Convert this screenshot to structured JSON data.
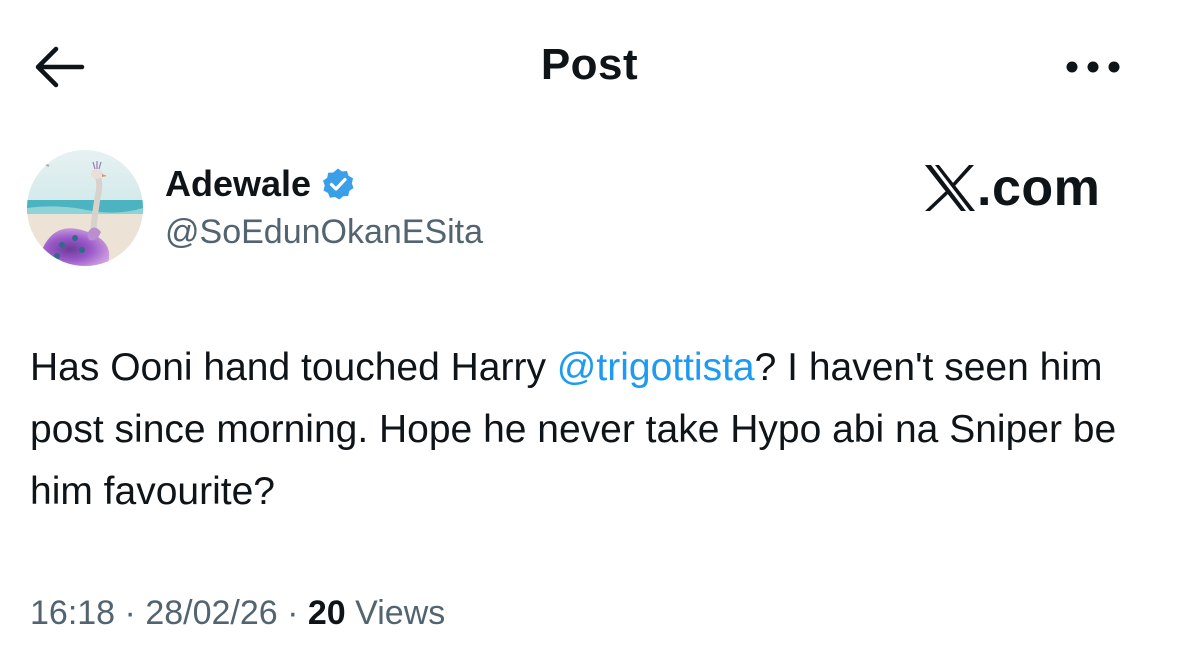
{
  "header": {
    "title": "Post",
    "back_icon": "arrow-left-icon",
    "more_icon": "more-horizontal-icon"
  },
  "author": {
    "display_name": "Adewale",
    "handle": "@SoEdunOkanESita",
    "verified": true,
    "verified_color": "#3b9ee8",
    "avatar_icon": "peacock-avatar"
  },
  "watermark": {
    "text": ".com",
    "logo_icon": "x-logo-icon"
  },
  "post": {
    "text_before": "Has Ooni hand touched Harry ",
    "mention": "@trigottista",
    "text_after": "? I haven't seen him post since morning. Hope he never take Hypo abi na Sniper be him favourite?"
  },
  "meta": {
    "time": "16:18",
    "separator1": " · ",
    "date": "28/02/26",
    "separator2": " · ",
    "views_count": "20",
    "views_label": " Views"
  },
  "colors": {
    "text": "#0f1419",
    "secondary": "#536471",
    "link": "#1d9bf0"
  }
}
